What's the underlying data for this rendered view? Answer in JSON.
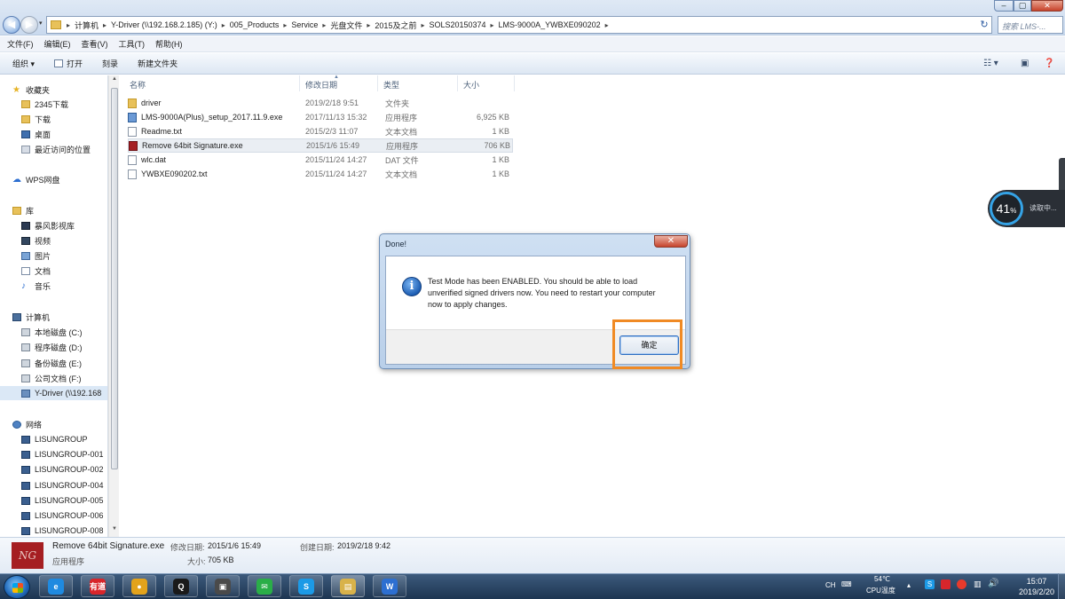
{
  "window": {
    "breadcrumbs": [
      "计算机",
      "Y-Driver (\\\\192.168.2.185) (Y:)",
      "005_Products",
      "Service",
      "光盘文件",
      "2015及之前",
      "SOLS20150374",
      "LMS-9000A_YWBXE090202"
    ],
    "search_placeholder": "搜索 LMS-...",
    "controls": {
      "min": "–",
      "max": "▢",
      "close": "✕"
    }
  },
  "menubar": [
    "文件(F)",
    "编辑(E)",
    "查看(V)",
    "工具(T)",
    "帮助(H)"
  ],
  "toolbar": {
    "organize": "组织 ▾",
    "open": "打开",
    "burn": "刻录",
    "new_folder": "新建文件夹"
  },
  "sidebar": {
    "favorites": {
      "label": "收藏夹",
      "items": [
        "2345下载",
        "下载",
        "桌面",
        "最近访问的位置"
      ]
    },
    "wps": "WPS网盘",
    "libraries": {
      "label": "库",
      "items": [
        "暴风影视库",
        "视频",
        "图片",
        "文档",
        "音乐"
      ]
    },
    "computer": {
      "label": "计算机",
      "items": [
        "本地磁盘 (C:)",
        "程序磁盘 (D:)",
        "备份磁盘 (E:)",
        "公司文档 (F:)",
        "Y-Driver (\\\\192.168"
      ]
    },
    "network": {
      "label": "网络",
      "items": [
        "LISUNGROUP",
        "LISUNGROUP-001",
        "LISUNGROUP-002",
        "LISUNGROUP-004",
        "LISUNGROUP-005",
        "LISUNGROUP-006",
        "LISUNGROUP-008"
      ]
    }
  },
  "columns": {
    "name": "名称",
    "date": "修改日期",
    "type": "类型",
    "size": "大小"
  },
  "files": [
    {
      "name": "driver",
      "date": "2019/2/18 9:51",
      "type": "文件夹",
      "size": "",
      "icon": "folder-icon"
    },
    {
      "name": "LMS-9000A(Plus)_setup_2017.11.9.exe",
      "date": "2017/11/13 15:32",
      "type": "应用程序",
      "size": "6,925 KB",
      "icon": "setup-exe-icon"
    },
    {
      "name": "Readme.txt",
      "date": "2015/2/3 11:07",
      "type": "文本文档",
      "size": "1 KB",
      "icon": "text-file-icon"
    },
    {
      "name": "Remove 64bit Signature.exe",
      "date": "2015/1/6 15:49",
      "type": "应用程序",
      "size": "706 KB",
      "icon": "app-exe-icon",
      "selected": true
    },
    {
      "name": "wlc.dat",
      "date": "2015/11/24 14:27",
      "type": "DAT 文件",
      "size": "1 KB",
      "icon": "dat-file-icon"
    },
    {
      "name": "YWBXE090202.txt",
      "date": "2015/11/24 14:27",
      "type": "文本文档",
      "size": "1 KB",
      "icon": "text-file-icon"
    }
  ],
  "details": {
    "thumb_text": "NG",
    "name": "Remove 64bit Signature.exe",
    "type": "应用程序",
    "modified_label": "修改日期:",
    "modified_value": "2015/1/6 15:49",
    "created_label": "创建日期:",
    "created_value": "2019/2/18 9:42",
    "size_label": "大小:",
    "size_value": "705 KB"
  },
  "dialog": {
    "title": "Done!",
    "close": "✕",
    "message": "Test Mode has been ENABLED. You should be able to load unverified signed drivers now. You need to restart your computer now to apply changes.",
    "ok_label": "确定",
    "highlight_color": "#f08a24"
  },
  "speed_widget": {
    "percent": "41",
    "unit": "%",
    "status": "读取中..."
  },
  "tray": {
    "lang": "CH",
    "temp": "54℃",
    "cpu": "CPU温度",
    "time": "15:07",
    "date": "2019/2/20"
  },
  "taskbar_apps": [
    {
      "name": "ie-icon",
      "glyph": "e",
      "color": "#1f8ae0"
    },
    {
      "name": "youdao-icon",
      "glyph": "有道",
      "color": "#d8262b"
    },
    {
      "name": "chrome-icon",
      "glyph": "●",
      "color": "#e3a31c"
    },
    {
      "name": "qq-icon",
      "glyph": "Q",
      "color": "#1a1a1a"
    },
    {
      "name": "video-editor-icon",
      "glyph": "▣",
      "color": "#4a4a4a"
    },
    {
      "name": "wechat-icon",
      "glyph": "✉",
      "color": "#2aae48"
    },
    {
      "name": "skype-icon",
      "glyph": "S",
      "color": "#1c9ae6"
    },
    {
      "name": "explorer-icon",
      "glyph": "▤",
      "color": "#d8b24a"
    },
    {
      "name": "wps-icon",
      "glyph": "W",
      "color": "#2d6fd1"
    }
  ]
}
